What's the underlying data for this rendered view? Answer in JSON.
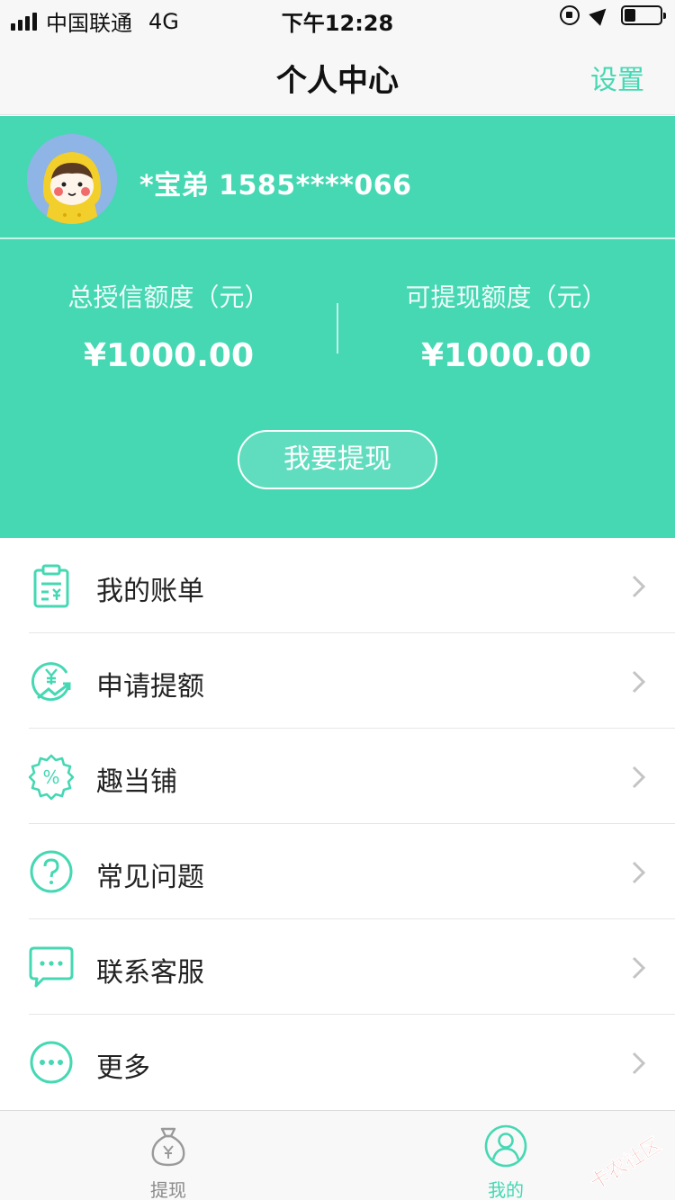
{
  "status_bar": {
    "carrier": "中国联通",
    "network": "4G",
    "time": "下午12:28"
  },
  "nav": {
    "title": "个人中心",
    "settings_label": "设置"
  },
  "profile": {
    "user_name": "*宝弟  1585****066",
    "total_credit_label": "总授信额度（元）",
    "total_credit_value": "¥1000.00",
    "available_label": "可提现额度（元）",
    "available_value": "¥1000.00",
    "withdraw_button": "我要提现"
  },
  "menu": [
    {
      "label": "我的账单",
      "icon": "bill-icon"
    },
    {
      "label": "申请提额",
      "icon": "raise-limit-icon"
    },
    {
      "label": "趣当铺",
      "icon": "percent-badge-icon"
    },
    {
      "label": "常见问题",
      "icon": "question-icon"
    },
    {
      "label": "联系客服",
      "icon": "chat-bubble-icon"
    },
    {
      "label": "更多",
      "icon": "more-icon"
    }
  ],
  "tabbar": {
    "tabs": [
      {
        "label": "提现",
        "icon": "money-bag-icon",
        "active": false
      },
      {
        "label": "我的",
        "icon": "user-icon",
        "active": true
      }
    ]
  },
  "watermark": "卡农社区",
  "colors": {
    "accent": "#45d8b3",
    "inactive_tab": "#8a8a8a"
  }
}
